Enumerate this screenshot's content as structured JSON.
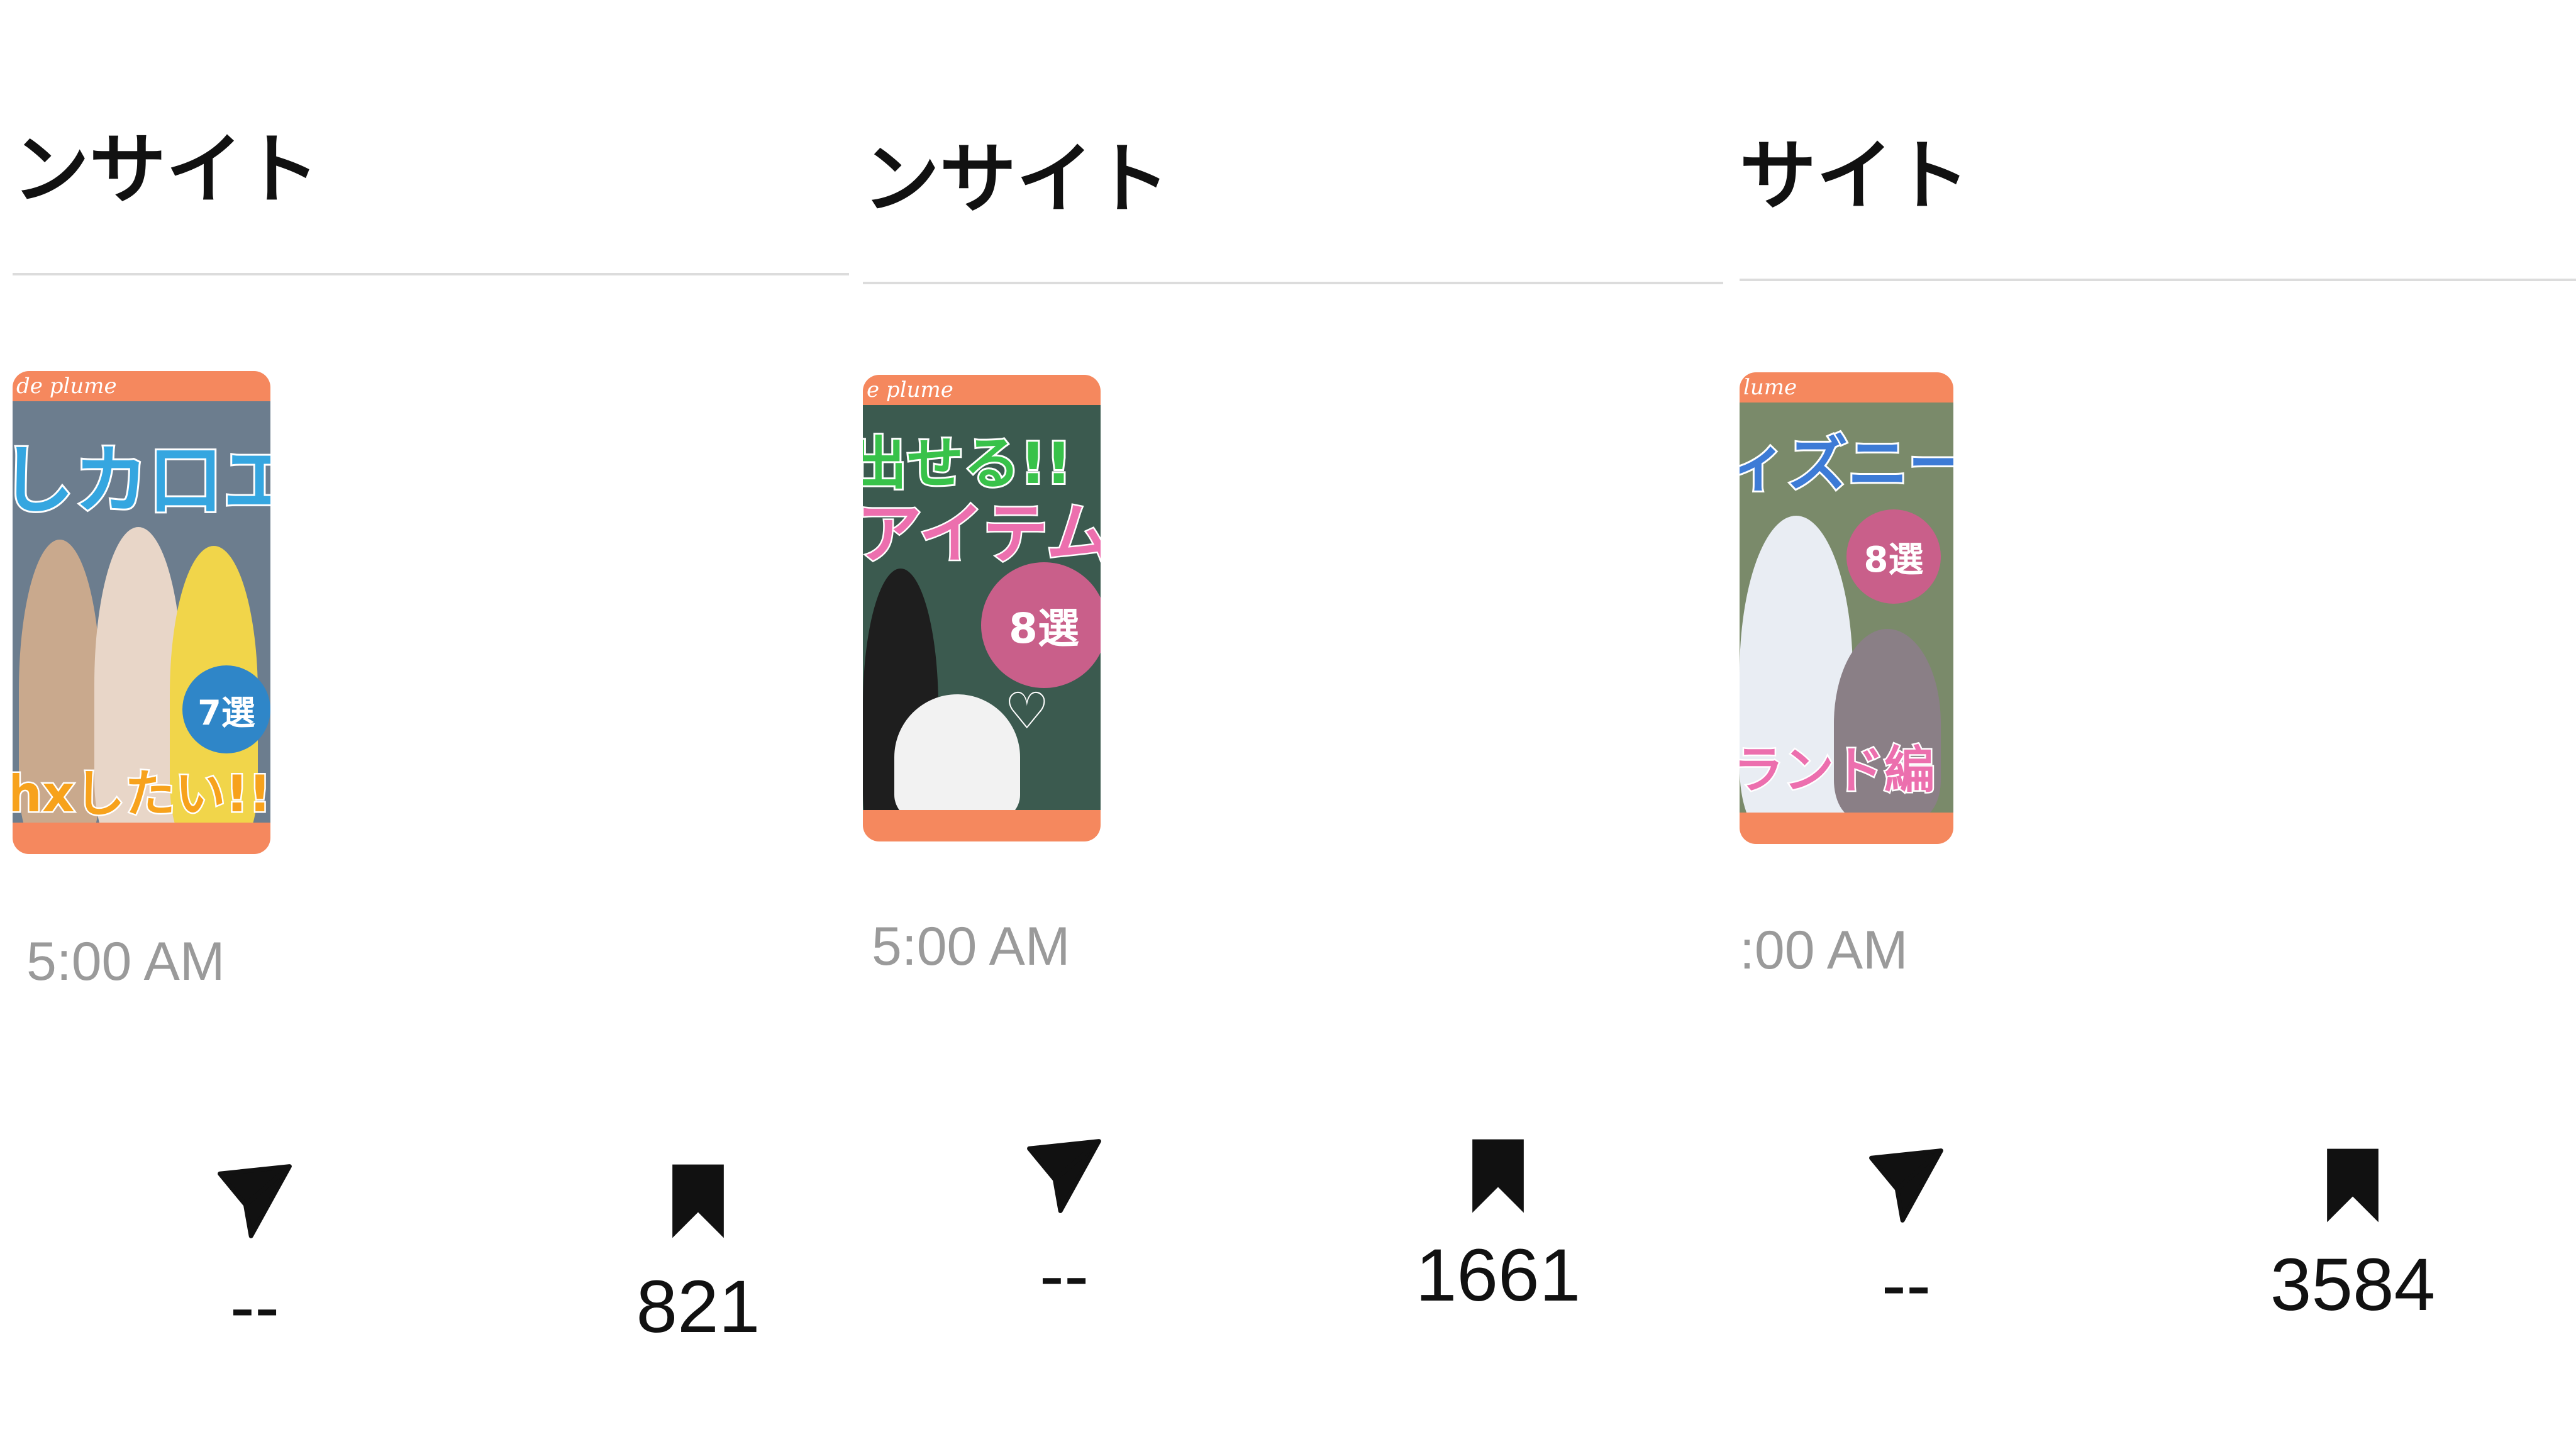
{
  "panels": [
    {
      "header_title": "ンサイト",
      "thumbnail": {
        "brand": "de plume",
        "headline": "しカ口エ",
        "subhead": "hxしたい!!",
        "badge": "7選",
        "badge_color": "#2f86c8",
        "headline_color": "#35a6e0",
        "subhead_color": "#f7a21c",
        "photo_color": "#6c7d8e"
      },
      "timestamp": "5:00 AM",
      "shares_label": "--",
      "saves_value": "821"
    },
    {
      "header_title": "ンサイト",
      "thumbnail": {
        "brand": "e plume",
        "headline": "出せる!!",
        "subhead": "アイテム",
        "badge": "8選",
        "badge_color": "#c95f8a",
        "headline_color": "#38c24a",
        "subhead_color": "#ec6fae",
        "photo_color": "#3b5a4f"
      },
      "timestamp": "5:00 AM",
      "shares_label": "--",
      "saves_value": "1661"
    },
    {
      "header_title": "サイト",
      "thumbnail": {
        "brand": "lume",
        "headline": "ィズニー",
        "subhead": "ランド編",
        "badge": "8選",
        "badge_color": "#c95f8a",
        "headline_color": "#3d7bd6",
        "subhead_color": "#ec6fae",
        "photo_color": "#7a8a6a"
      },
      "timestamp": ":00 AM",
      "shares_label": "--",
      "saves_value": "3584"
    }
  ],
  "icons": {
    "share": "send-icon",
    "save": "bookmark-icon"
  },
  "colors": {
    "thumbnail_frame": "#f5885e",
    "text_primary": "#111111",
    "text_secondary": "#9a9a9a",
    "divider": "#dcdcdc"
  }
}
